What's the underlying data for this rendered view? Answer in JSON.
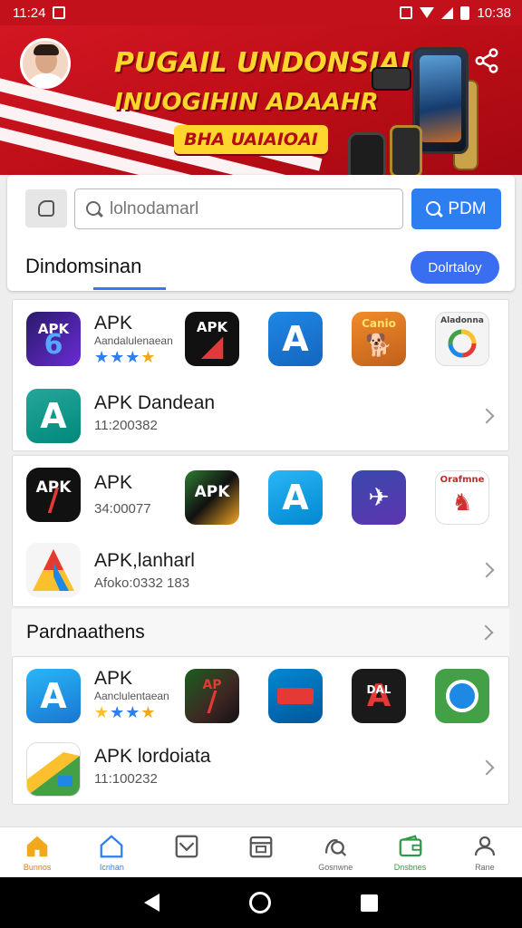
{
  "status_bar": {
    "time_left": "11:24",
    "time_right": "10:38"
  },
  "banner": {
    "headline_1": "PUGAIL UNDONSIAI",
    "headline_2": "INUOGIHIN ADAAHR",
    "promo": "BHA UAIAIOAI"
  },
  "search": {
    "placeholder": "lolnodamarl",
    "button_label": "PDM",
    "tab_title": "Dindomsinan",
    "pill_label": "Dolrtaloy"
  },
  "cards": [
    {
      "rows": [
        {
          "name": "APK",
          "subtitle": "Aandalulenaean",
          "rating_stars": 4,
          "icons": [
            "apk-purple-icon",
            "apk-dark-icon",
            "app-store-icon",
            "camera-dog-icon",
            "google-colors-icon"
          ],
          "icon_labels": [
            "APK",
            "APK",
            "",
            "Canio",
            "Aladonna"
          ]
        },
        {
          "name": "APK Dandean",
          "subtitle": "11:200382"
        }
      ]
    },
    {
      "rows": [
        {
          "name": "APK",
          "subtitle": "34:00077",
          "icons": [
            "apk-black-icon",
            "apk-yellow-icon",
            "app-store-icon",
            "plane-purple-icon",
            "red-dragon-icon"
          ],
          "icon_labels": [
            "APK",
            "APK",
            "",
            "",
            "Orafmne"
          ]
        },
        {
          "name": "APK,lanharl",
          "subtitle": "Afoko:0332 183"
        }
      ]
    },
    {
      "section_title": "Pardnaathens",
      "rows": [
        {
          "name": "APK",
          "subtitle": "Aanclulentaean",
          "rating_stars": 4,
          "icons": [
            "app-store-icon",
            "jungle-apk-icon",
            "ticket-app-icon",
            "red-a-icon",
            "green-shield-icon"
          ],
          "icon_labels": [
            "",
            "AP",
            "",
            "DAL",
            ""
          ]
        },
        {
          "name": "APK lordoiata",
          "subtitle": "11:100232"
        }
      ]
    }
  ],
  "bottom_nav": [
    {
      "label": "Bunnos",
      "icon": "home-icon",
      "active": true
    },
    {
      "label": "Icnhan",
      "icon": "house-outline-icon"
    },
    {
      "label": "",
      "icon": "check-box-icon"
    },
    {
      "label": "",
      "icon": "calendar-icon"
    },
    {
      "label": "Gosnwne",
      "icon": "search-person-icon"
    },
    {
      "label": "Dnsbnes",
      "icon": "wallet-icon"
    },
    {
      "label": "Rane",
      "icon": "profile-icon"
    }
  ],
  "colors": {
    "brand_red": "#c3111b",
    "accent_blue": "#2d7ef0",
    "headline_yellow": "#ffd62e"
  }
}
